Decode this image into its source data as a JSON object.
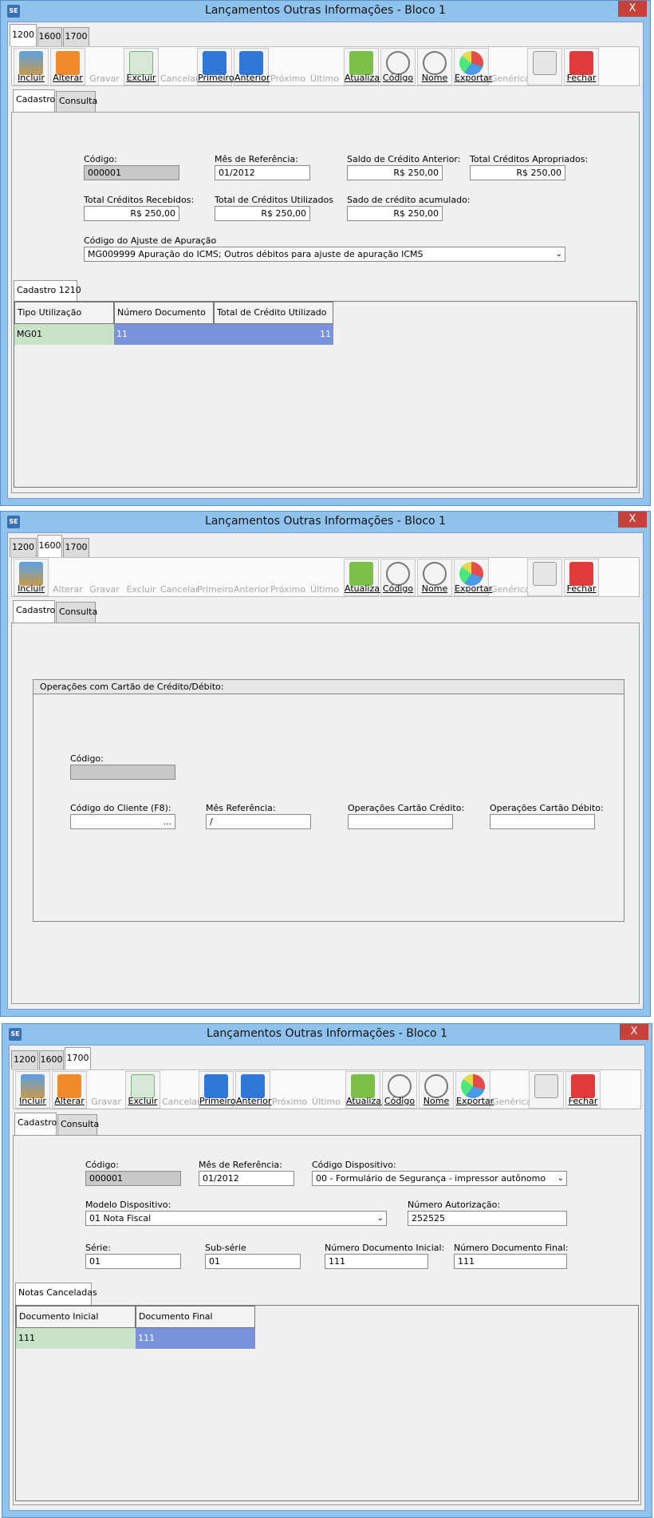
{
  "colors": {
    "titlebar": "#8fc3ee",
    "close": "#c7403a",
    "green_cell": "#c7e2c6",
    "blue_cell": "#7b92dc",
    "readonly": "#c8c8c8"
  },
  "window_title": "Lançamentos Outras Informações - Bloco 1",
  "app_icon": "SE",
  "close_glyph": "X",
  "top_tabs": [
    "1200",
    "1600",
    "1700"
  ],
  "sub_tabs": {
    "cadastro": "Cadastro",
    "consulta": "Consulta"
  },
  "toolbar": {
    "incluir": "Incluir",
    "alterar": "Alterar",
    "gravar": "Gravar",
    "excluir": "Excluir",
    "cancelar": "Cancelar",
    "primeiro": "Primeiro",
    "anterior": "Anterior",
    "proximo": "Próximo",
    "ultimo": "Último",
    "atualizar": "Atualizar",
    "codigo": "Código",
    "nome": "Nome",
    "exportar": "Exportar",
    "generica": "Genérica",
    "fechar": "Fechar"
  },
  "b1200": {
    "codigo_label": "Código:",
    "codigo_value": "000001",
    "mes_label": "Mês de Referência:",
    "mes_value": "01/2012",
    "saldo_label": "Saldo de Crédito Anterior:",
    "saldo_value": "R$ 250,00",
    "apropriados_label": "Total Créditos Apropriados:",
    "apropriados_value": "R$ 250,00",
    "recebidos_label": "Total Créditos Recebidos:",
    "recebidos_value": "R$ 250,00",
    "utilizados_label": "Total de Créditos Utilizados",
    "utilizados_value": "R$ 250,00",
    "acumulado_label": "Sado de crédito acumulado:",
    "acumulado_value": "R$ 250,00",
    "ajuste_label": "Código do Ajuste de Apuração",
    "ajuste_value": "MG009999 Apuração do ICMS; Outros débitos para ajuste de apuração ICMS",
    "inner_tab": "Cadastro 1210",
    "grid_headers": [
      "Tipo Utilização",
      "Número Documento",
      "Total de Crédito Utilizado"
    ],
    "grid_rows": [
      [
        "MG01",
        "11",
        "11"
      ]
    ]
  },
  "b1600": {
    "group_title": "Operações com Cartão de Crédito/Débito:",
    "codigo_label": "Código:",
    "codigo_value": "",
    "cliente_label": "Código do Cliente (F8):",
    "cliente_value": "...",
    "mes_label": "Mês Referência:",
    "mes_value": "/",
    "credito_label": "Operações Cartão Crédito:",
    "credito_value": "",
    "debito_label": "Operações Cartão Débito:",
    "debito_value": ""
  },
  "b1700": {
    "codigo_label": "Código:",
    "codigo_value": "000001",
    "mes_label": "Mês de Referência:",
    "mes_value": "01/2012",
    "disp_label": "Código Dispositivo:",
    "disp_value": "00 - Formulário de Segurança - impressor autônomo",
    "modelo_label": "Modelo Dispositivo:",
    "modelo_value": "01 Nota Fiscal",
    "aut_label": "Número Autorização:",
    "aut_value": "252525",
    "serie_label": "Série:",
    "serie_value": "01",
    "subserie_label": "Sub-série",
    "subserie_value": "01",
    "docini_label": "Número Documento Inicial:",
    "docini_value": "111",
    "docfim_label": "Número Documento Final:",
    "docfim_value": "111",
    "inner_tab": "Notas Canceladas",
    "grid_headers": [
      "Documento Inicial",
      "Documento Final"
    ],
    "grid_rows": [
      [
        "111",
        "111"
      ]
    ]
  }
}
